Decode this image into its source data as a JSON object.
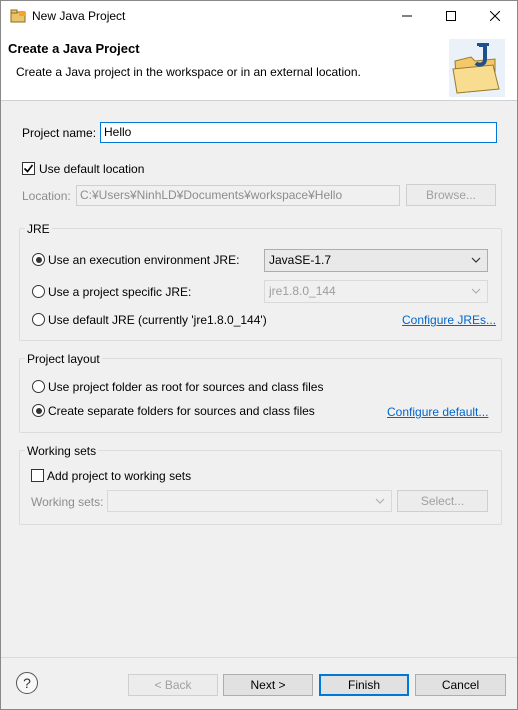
{
  "window": {
    "title": "New Java Project"
  },
  "header": {
    "title": "Create a Java Project",
    "description": "Create a Java project in the workspace or in an external location."
  },
  "project": {
    "name_label": "Project name:",
    "name_value": "Hello"
  },
  "location": {
    "use_default_label": "Use default location",
    "use_default_checked": true,
    "location_label": "Location:",
    "location_value": "C:¥Users¥NinhLD¥Documents¥workspace¥Hello",
    "browse_label": "Browse..."
  },
  "jre": {
    "group_title": "JRE",
    "option_env_label": "Use an execution environment JRE:",
    "option_env_value": "JavaSE-1.7",
    "option_specific_label": "Use a project specific JRE:",
    "option_specific_value": "jre1.8.0_144",
    "option_default_label": "Use default JRE (currently 'jre1.8.0_144')",
    "configure_link": "Configure JREs...",
    "selected": "execution-environment"
  },
  "layout": {
    "group_title": "Project layout",
    "option_root_label": "Use project folder as root for sources and class files",
    "option_separate_label": "Create separate folders for sources and class files",
    "configure_link": "Configure default...",
    "selected": "separate"
  },
  "working_sets": {
    "group_title": "Working sets",
    "add_label": "Add project to working sets",
    "add_checked": false,
    "sets_label": "Working sets:",
    "sets_value": "",
    "select_label": "Select..."
  },
  "footer": {
    "help_icon": "help-icon",
    "back_label": "< Back",
    "next_label": "Next >",
    "finish_label": "Finish",
    "cancel_label": "Cancel"
  },
  "colors": {
    "accent": "#0078d7",
    "link": "#0066cc"
  }
}
